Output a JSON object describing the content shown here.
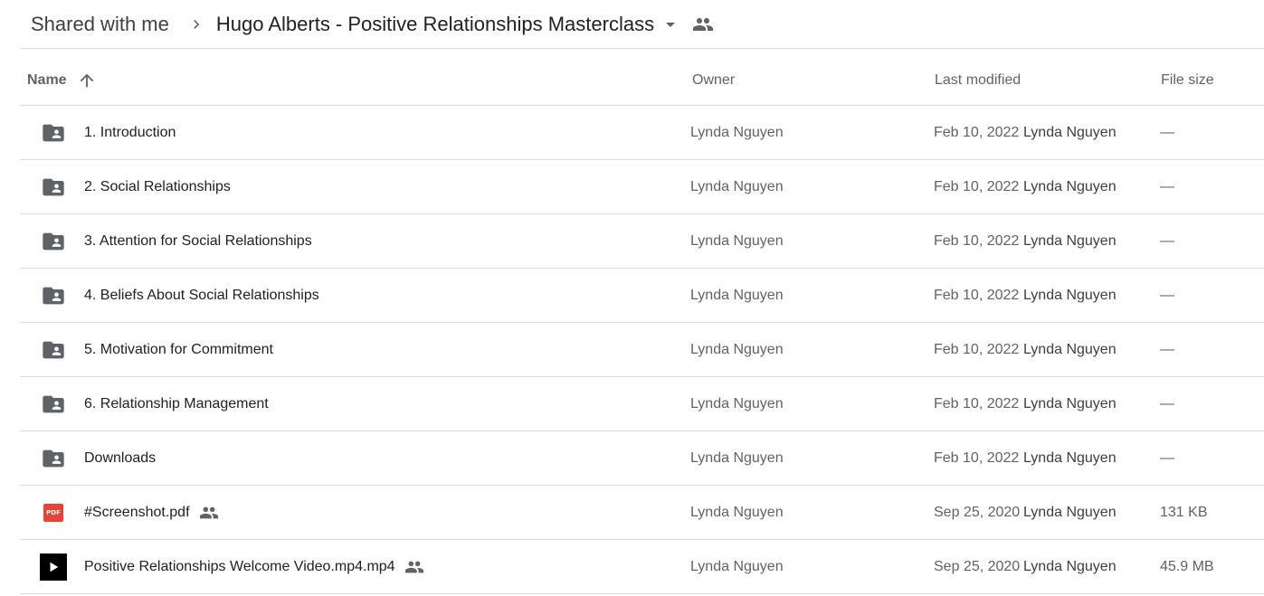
{
  "breadcrumb": {
    "root": "Shared with me",
    "current": "Hugo Alberts - Positive Relationships Masterclass"
  },
  "columns": {
    "name": "Name",
    "owner": "Owner",
    "last_modified": "Last modified",
    "file_size": "File size"
  },
  "icons": {
    "sort": "arrow-up-icon",
    "shared_folder": "shared-folder-icon",
    "pdf": "pdf-icon",
    "video": "video-icon",
    "shared": "people-icon"
  },
  "colors": {
    "pdf": "#ea4335",
    "folder": "#5f6368",
    "divider": "#dadce0"
  },
  "files": [
    {
      "name": "1. Introduction",
      "owner": "Lynda Nguyen",
      "date": "Feb 10, 2022",
      "modified_by": "Lynda Nguyen",
      "size": "—"
    },
    {
      "name": "2. Social Relationships",
      "owner": "Lynda Nguyen",
      "date": "Feb 10, 2022",
      "modified_by": "Lynda Nguyen",
      "size": "—"
    },
    {
      "name": "3. Attention for Social Relationships",
      "owner": "Lynda Nguyen",
      "date": "Feb 10, 2022",
      "modified_by": "Lynda Nguyen",
      "size": "—"
    },
    {
      "name": "4. Beliefs About Social Relationships",
      "owner": "Lynda Nguyen",
      "date": "Feb 10, 2022",
      "modified_by": "Lynda Nguyen",
      "size": "—"
    },
    {
      "name": "5. Motivation for Commitment",
      "owner": "Lynda Nguyen",
      "date": "Feb 10, 2022",
      "modified_by": "Lynda Nguyen",
      "size": "—"
    },
    {
      "name": "6. Relationship Management",
      "owner": "Lynda Nguyen",
      "date": "Feb 10, 2022",
      "modified_by": "Lynda Nguyen",
      "size": "—"
    },
    {
      "name": "Downloads",
      "owner": "Lynda Nguyen",
      "date": "Feb 10, 2022",
      "modified_by": "Lynda Nguyen",
      "size": "—"
    },
    {
      "name": "#Screenshot.pdf",
      "owner": "Lynda Nguyen",
      "date": "Sep 25, 2020",
      "modified_by": "Lynda Nguyen",
      "size": "131 KB",
      "badge": "PDF"
    },
    {
      "name": "Positive Relationships Welcome Video.mp4.mp4",
      "owner": "Lynda Nguyen",
      "date": "Sep 25, 2020",
      "modified_by": "Lynda Nguyen",
      "size": "45.9 MB"
    }
  ]
}
